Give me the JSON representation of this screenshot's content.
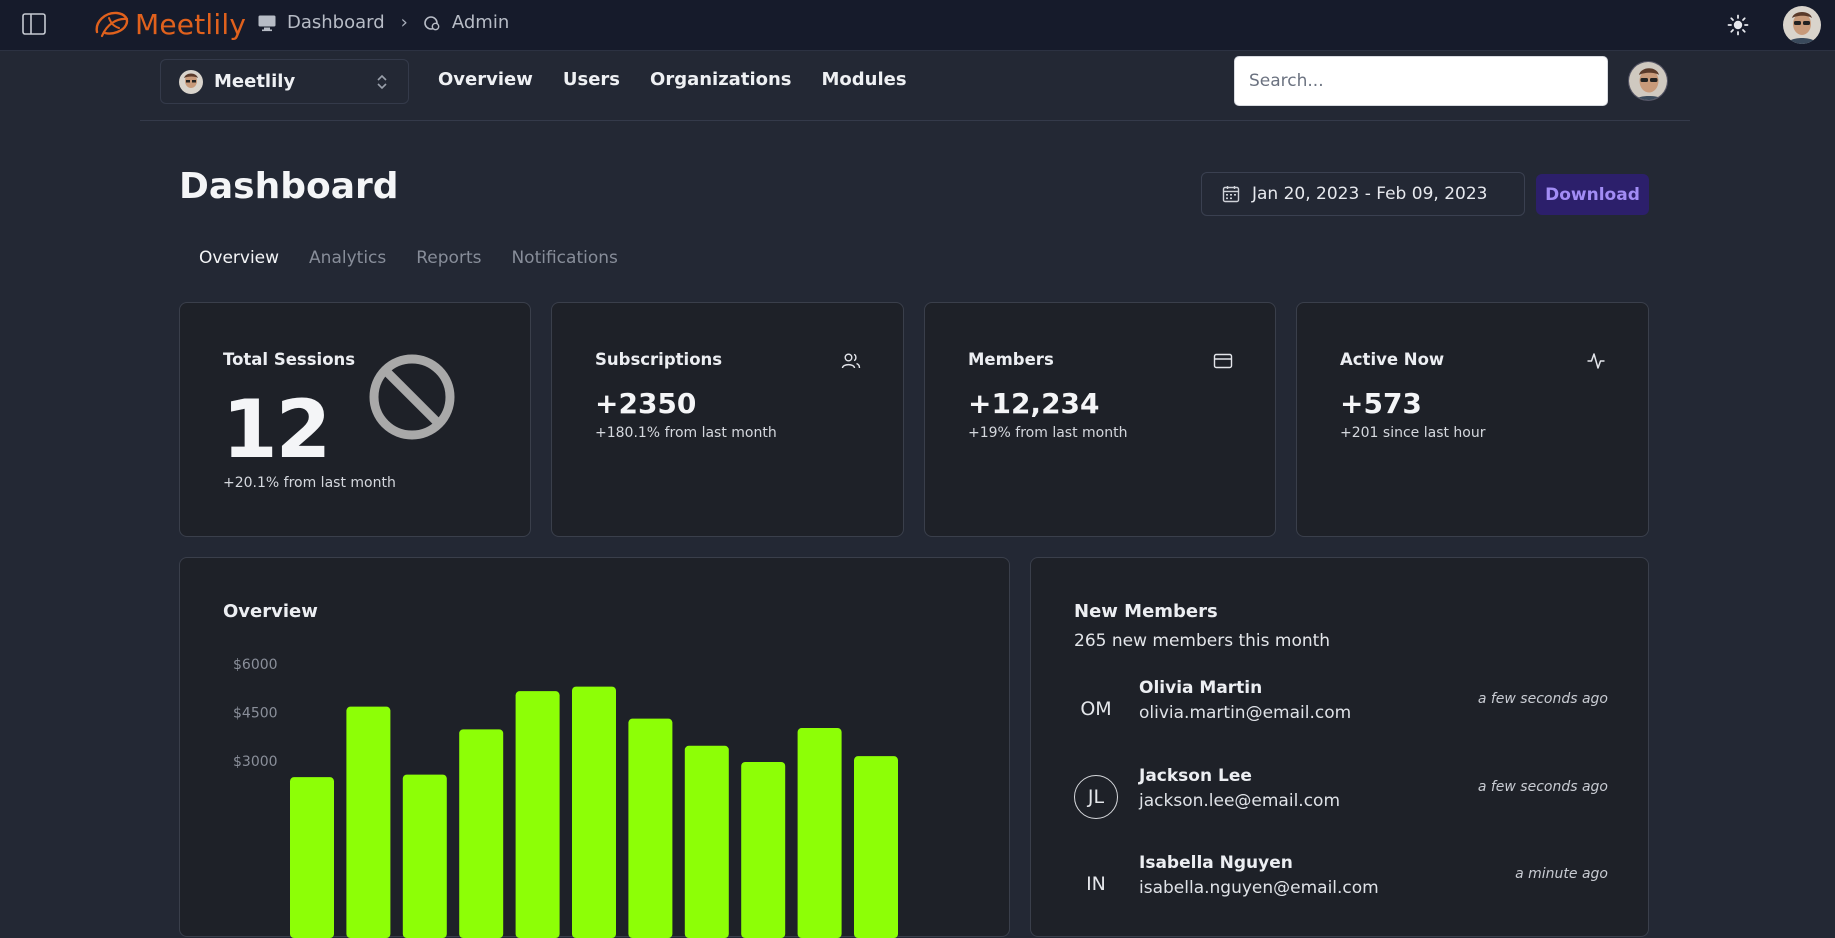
{
  "topbar": {
    "brand": "Meetlily",
    "breadcrumb": [
      "Dashboard",
      "Admin"
    ]
  },
  "subnav": {
    "team": "Meetlily",
    "links": [
      "Overview",
      "Users",
      "Organizations",
      "Modules"
    ],
    "search_placeholder": "Search..."
  },
  "page": {
    "title": "Dashboard",
    "date_range": "Jan 20, 2023 - Feb 09, 2023",
    "download_label": "Download",
    "tabs": [
      "Overview",
      "Analytics",
      "Reports",
      "Notifications"
    ]
  },
  "stats": [
    {
      "title": "Total Sessions",
      "value": "12",
      "sub": "+20.1% from last month",
      "icon": "ban-icon"
    },
    {
      "title": "Subscriptions",
      "value": "+2350",
      "sub": "+180.1% from last month",
      "icon": "users-icon"
    },
    {
      "title": "Members",
      "value": "+12,234",
      "sub": "+19% from last month",
      "icon": "credit-card-icon"
    },
    {
      "title": "Active Now",
      "value": "+573",
      "sub": "+201 since last hour",
      "icon": "activity-icon"
    }
  ],
  "overview": {
    "title": "Overview"
  },
  "chart_data": {
    "type": "bar",
    "title": "Overview",
    "ytick_labels": [
      "$6000",
      "$4500",
      "$3000"
    ],
    "yticks": [
      6000,
      4500,
      3000
    ],
    "values": [
      2500,
      4680,
      2580,
      3980,
      5160,
      5300,
      4310,
      3470,
      2970,
      4020,
      3150
    ],
    "bar_color": "#8dff06"
  },
  "members": {
    "title": "New Members",
    "subtitle": "265 new members this month",
    "items": [
      {
        "initials": "OM",
        "name": "Olivia Martin",
        "email": "olivia.martin@email.com",
        "time": "a few seconds ago",
        "ring": false
      },
      {
        "initials": "JL",
        "name": "Jackson Lee",
        "email": "jackson.lee@email.com",
        "time": "a few seconds ago",
        "ring": true
      },
      {
        "initials": "IN",
        "name": "Isabella Nguyen",
        "email": "isabella.nguyen@email.com",
        "time": "a minute ago",
        "ring": false
      }
    ]
  },
  "colors": {
    "accent": "#e0611d",
    "download_bg": "#2c1f6b",
    "download_text": "#a28cf5",
    "bar": "#8dff06"
  }
}
